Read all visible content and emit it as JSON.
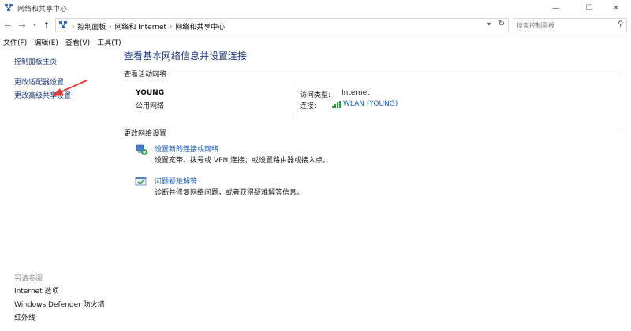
{
  "window": {
    "title": "网络和共享中心",
    "controls": {
      "minimize": "—",
      "maximize": "☐",
      "close": "✕"
    }
  },
  "address": {
    "crumbs": [
      "控制面板",
      "网络和 Internet",
      "网络和共享中心"
    ],
    "search_placeholder": "搜索控制面板"
  },
  "menu": [
    "文件(F)",
    "编辑(E)",
    "查看(V)",
    "工具(T)"
  ],
  "sidebar": {
    "links": [
      "控制面板主页",
      "更改适配器设置",
      "更改高级共享设置"
    ],
    "see_also_header": "另请参阅",
    "see_also": [
      "Internet 选项",
      "Windows Defender 防火墙",
      "红外线"
    ]
  },
  "main": {
    "title": "查看基本网络信息并设置连接",
    "active_section": "查看活动网络",
    "network": {
      "name": "YOUNG",
      "category": "公用网络",
      "access_type_label": "访问类型:",
      "access_type_value": "Internet",
      "connection_label": "连接:",
      "connection_value": "WLAN (YOUNG)"
    },
    "change_section": "更改网络设置",
    "tasks": [
      {
        "title": "设置新的连接或网络",
        "desc": "设置宽带、拨号或 VPN 连接；或设置路由器或接入点。",
        "icon": "network-setup-icon"
      },
      {
        "title": "问题疑难解答",
        "desc": "诊断并修复网络问题，或者获得疑难解答信息。",
        "icon": "troubleshoot-icon"
      }
    ]
  },
  "colors": {
    "link": "#1a5fb4",
    "title": "#1e3a78",
    "signal": "#2e9b3e",
    "annotation_arrow": "#e53935"
  }
}
